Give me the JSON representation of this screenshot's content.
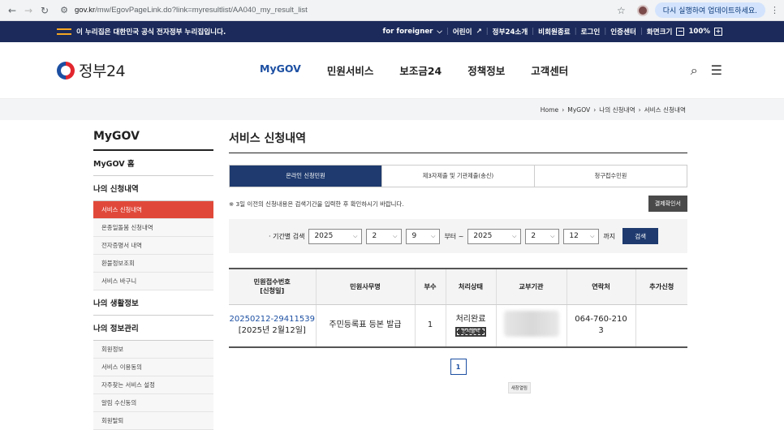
{
  "browser": {
    "url_host": "gov.kr",
    "url_path": "/mw/EgovPageLink.do?link=myresultlist/AA040_my_result_list",
    "update_label": "다시 실행하여 업데이트하세요."
  },
  "banner": {
    "text": "이 누리집은 대한민국 공식 전자정부 누리집입니다.",
    "links": [
      "for foreigner",
      "어린이",
      "정부24소개",
      "비회원종료",
      "로그인",
      "인증센터",
      "화면크기",
      "100%"
    ]
  },
  "header": {
    "logo": "정부24",
    "nav": [
      "MyGOV",
      "민원서비스",
      "보조금24",
      "정책정보",
      "고객센터"
    ]
  },
  "breadcrumb": [
    "Home",
    "MyGOV",
    "나의 신청내역",
    "서비스 신청내역"
  ],
  "lnb": {
    "title": "MyGOV",
    "home": "MyGOV 홈",
    "my_applications": "나의 신청내역",
    "app_sub": [
      "서비스 신청내역",
      "온종일돌봄 신청내역",
      "전자증명서 내역",
      "환불정보조회",
      "서비스 바구니"
    ],
    "my_life": "나의 생활정보",
    "my_info": "나의 정보관리",
    "info_sub": [
      "회원정보",
      "서비스 이용동의",
      "자주찾는 서비스 설정",
      "알림 수신동의",
      "회원탈퇴"
    ]
  },
  "main": {
    "title": "서비스 신청내역",
    "tabs": [
      "온라인 신청민원",
      "제3자제출 및 기관제출(송신)",
      "청구접수민원"
    ],
    "notice": "※ 3일 이전의 신청내용은 검색기간을 입력한 후 확인하시기 바랍니다.",
    "confirm_btn": "결제확인서",
    "search": {
      "label": "· 기간별 검색",
      "from_year": "2025",
      "from_month": "2",
      "from_day": "9",
      "from_suffix": "부터 ~",
      "to_year": "2025",
      "to_month": "2",
      "to_day": "12",
      "to_suffix": "까지",
      "button": "검색"
    },
    "table": {
      "headers": [
        "민원접수번호\n[신청일]",
        "민원사무명",
        "부수",
        "처리상태",
        "교부기관",
        "연락처",
        "추가신청"
      ],
      "row": {
        "app_no": "20250212-29411539",
        "app_date": "[2025년 2월12일]",
        "service": "주민등록표 등본 발급",
        "copies": "1",
        "status": "처리완료",
        "print_btn": "문서출력",
        "contact_line1": "064-760-210",
        "contact_line2": "3"
      }
    },
    "page": "1",
    "new_window": "새창열림"
  }
}
